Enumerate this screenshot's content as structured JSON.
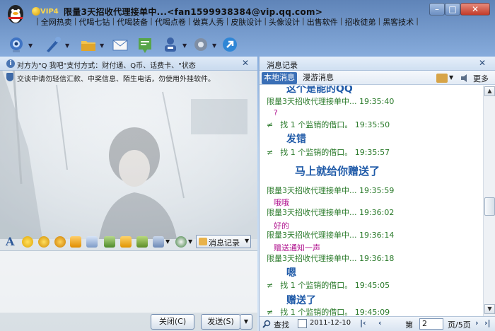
{
  "window": {
    "vip": "VIP4",
    "title": "限量3天招收代理接单中...<fan1599938384@vip.qq.com>",
    "minimize_label": "–",
    "maximize_label": "□",
    "close_label": "✕"
  },
  "nav_links": [
    "全网热卖",
    "代喝七钻",
    "代喝装备",
    "代喝点卷",
    "做真人秀",
    "皮肤设计",
    "头像设计",
    "出售软件",
    "招收徒弟",
    "黑客技术"
  ],
  "notice": {
    "text": "对方为\"Q 我吧\"支付方式：财付通、Q币、话费卡、\"状态",
    "close": "✕"
  },
  "warning": {
    "text": "交谈中请勿轻信汇款、中奖信息、陌生电话，勿使用外挂软件。"
  },
  "format_bar": {
    "font_icon_label": "A",
    "history_button": "消息记录"
  },
  "buttons": {
    "close_chat": "关闭(C)",
    "send": "发送(S)",
    "send_menu": "▼"
  },
  "history": {
    "title": "消息记录",
    "close": "✕",
    "tabs": [
      "本地消息",
      "漫游消息"
    ],
    "more": "更多",
    "search": "查找",
    "date": "2011-12-10",
    "page_label": "第",
    "page_value": "2",
    "page_total": "页/5页",
    "first": "|‹",
    "prev": "‹",
    "next": "›",
    "last": "›|",
    "scroll_up": "▲",
    "scroll_down": "▼",
    "messages": [
      {
        "kind": "body",
        "text": "这个是能的QQ",
        "color": "#1f5aa8"
      },
      {
        "kind": "hdr",
        "text": "限量3天招收代理接单中... 19:35:40"
      },
      {
        "kind": "body",
        "text": "?",
        "color": "#b0138f"
      },
      {
        "kind": "sys",
        "text": "找 1 个监销的借口。 19:35:50"
      },
      {
        "kind": "body",
        "text": "发错",
        "color": "#1f5aa8"
      },
      {
        "kind": "sys",
        "text": "找 1 个监销的借口。 19:35:57"
      },
      {
        "kind": "body",
        "text": "马上就给你赠送了",
        "color": "#1f5aa8"
      },
      {
        "kind": "hdr",
        "text": "限量3天招收代理接单中... 19:35:59"
      },
      {
        "kind": "body",
        "text": "哦哦",
        "color": "#b0138f"
      },
      {
        "kind": "hdr",
        "text": "限量3天招收代理接单中... 19:36:02"
      },
      {
        "kind": "body",
        "text": "好的",
        "color": "#b0138f"
      },
      {
        "kind": "hdr",
        "text": "限量3天招收代理接单中... 19:36:14"
      },
      {
        "kind": "body",
        "text": "赠送通知一声",
        "color": "#b0138f"
      },
      {
        "kind": "hdr",
        "text": "限量3天招收代理接单中... 19:36:18"
      },
      {
        "kind": "body",
        "text": "嗯",
        "color": "#1f5aa8"
      },
      {
        "kind": "sys",
        "text": "找 1 个监销的借口。 19:45:05"
      },
      {
        "kind": "body",
        "text": "赠送了",
        "color": "#1f5aa8"
      },
      {
        "kind": "sys",
        "text": "找 1 个监销的借口。 19:45:09"
      }
    ]
  },
  "colors": {
    "accent": "#3a6fb6",
    "header_green": "#2a7a2a",
    "msg_blue": "#1f5aa8",
    "msg_purple": "#b0138f"
  }
}
